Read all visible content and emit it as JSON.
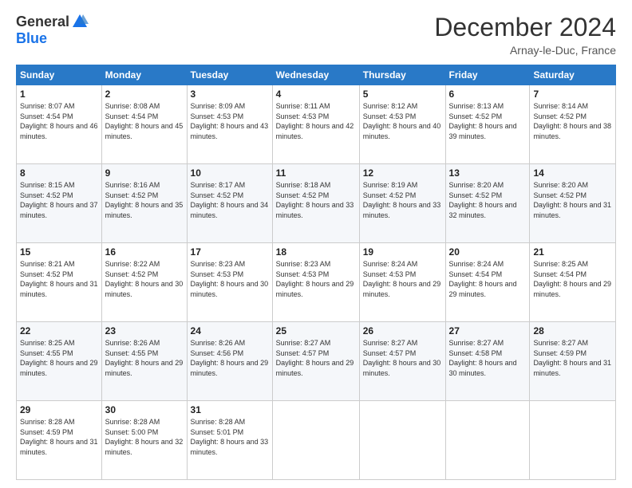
{
  "logo": {
    "general": "General",
    "blue": "Blue"
  },
  "title": "December 2024",
  "location": "Arnay-le-Duc, France",
  "days_of_week": [
    "Sunday",
    "Monday",
    "Tuesday",
    "Wednesday",
    "Thursday",
    "Friday",
    "Saturday"
  ],
  "weeks": [
    [
      {
        "day": "1",
        "sunrise": "8:07 AM",
        "sunset": "4:54 PM",
        "daylight": "8 hours and 46 minutes."
      },
      {
        "day": "2",
        "sunrise": "8:08 AM",
        "sunset": "4:54 PM",
        "daylight": "8 hours and 45 minutes."
      },
      {
        "day": "3",
        "sunrise": "8:09 AM",
        "sunset": "4:53 PM",
        "daylight": "8 hours and 43 minutes."
      },
      {
        "day": "4",
        "sunrise": "8:11 AM",
        "sunset": "4:53 PM",
        "daylight": "8 hours and 42 minutes."
      },
      {
        "day": "5",
        "sunrise": "8:12 AM",
        "sunset": "4:53 PM",
        "daylight": "8 hours and 40 minutes."
      },
      {
        "day": "6",
        "sunrise": "8:13 AM",
        "sunset": "4:52 PM",
        "daylight": "8 hours and 39 minutes."
      },
      {
        "day": "7",
        "sunrise": "8:14 AM",
        "sunset": "4:52 PM",
        "daylight": "8 hours and 38 minutes."
      }
    ],
    [
      {
        "day": "8",
        "sunrise": "8:15 AM",
        "sunset": "4:52 PM",
        "daylight": "8 hours and 37 minutes."
      },
      {
        "day": "9",
        "sunrise": "8:16 AM",
        "sunset": "4:52 PM",
        "daylight": "8 hours and 35 minutes."
      },
      {
        "day": "10",
        "sunrise": "8:17 AM",
        "sunset": "4:52 PM",
        "daylight": "8 hours and 34 minutes."
      },
      {
        "day": "11",
        "sunrise": "8:18 AM",
        "sunset": "4:52 PM",
        "daylight": "8 hours and 33 minutes."
      },
      {
        "day": "12",
        "sunrise": "8:19 AM",
        "sunset": "4:52 PM",
        "daylight": "8 hours and 33 minutes."
      },
      {
        "day": "13",
        "sunrise": "8:20 AM",
        "sunset": "4:52 PM",
        "daylight": "8 hours and 32 minutes."
      },
      {
        "day": "14",
        "sunrise": "8:20 AM",
        "sunset": "4:52 PM",
        "daylight": "8 hours and 31 minutes."
      }
    ],
    [
      {
        "day": "15",
        "sunrise": "8:21 AM",
        "sunset": "4:52 PM",
        "daylight": "8 hours and 31 minutes."
      },
      {
        "day": "16",
        "sunrise": "8:22 AM",
        "sunset": "4:52 PM",
        "daylight": "8 hours and 30 minutes."
      },
      {
        "day": "17",
        "sunrise": "8:23 AM",
        "sunset": "4:53 PM",
        "daylight": "8 hours and 30 minutes."
      },
      {
        "day": "18",
        "sunrise": "8:23 AM",
        "sunset": "4:53 PM",
        "daylight": "8 hours and 29 minutes."
      },
      {
        "day": "19",
        "sunrise": "8:24 AM",
        "sunset": "4:53 PM",
        "daylight": "8 hours and 29 minutes."
      },
      {
        "day": "20",
        "sunrise": "8:24 AM",
        "sunset": "4:54 PM",
        "daylight": "8 hours and 29 minutes."
      },
      {
        "day": "21",
        "sunrise": "8:25 AM",
        "sunset": "4:54 PM",
        "daylight": "8 hours and 29 minutes."
      }
    ],
    [
      {
        "day": "22",
        "sunrise": "8:25 AM",
        "sunset": "4:55 PM",
        "daylight": "8 hours and 29 minutes."
      },
      {
        "day": "23",
        "sunrise": "8:26 AM",
        "sunset": "4:55 PM",
        "daylight": "8 hours and 29 minutes."
      },
      {
        "day": "24",
        "sunrise": "8:26 AM",
        "sunset": "4:56 PM",
        "daylight": "8 hours and 29 minutes."
      },
      {
        "day": "25",
        "sunrise": "8:27 AM",
        "sunset": "4:57 PM",
        "daylight": "8 hours and 29 minutes."
      },
      {
        "day": "26",
        "sunrise": "8:27 AM",
        "sunset": "4:57 PM",
        "daylight": "8 hours and 30 minutes."
      },
      {
        "day": "27",
        "sunrise": "8:27 AM",
        "sunset": "4:58 PM",
        "daylight": "8 hours and 30 minutes."
      },
      {
        "day": "28",
        "sunrise": "8:27 AM",
        "sunset": "4:59 PM",
        "daylight": "8 hours and 31 minutes."
      }
    ],
    [
      {
        "day": "29",
        "sunrise": "8:28 AM",
        "sunset": "4:59 PM",
        "daylight": "8 hours and 31 minutes."
      },
      {
        "day": "30",
        "sunrise": "8:28 AM",
        "sunset": "5:00 PM",
        "daylight": "8 hours and 32 minutes."
      },
      {
        "day": "31",
        "sunrise": "8:28 AM",
        "sunset": "5:01 PM",
        "daylight": "8 hours and 33 minutes."
      },
      null,
      null,
      null,
      null
    ]
  ],
  "labels": {
    "sunrise": "Sunrise:",
    "sunset": "Sunset:",
    "daylight": "Daylight:"
  }
}
